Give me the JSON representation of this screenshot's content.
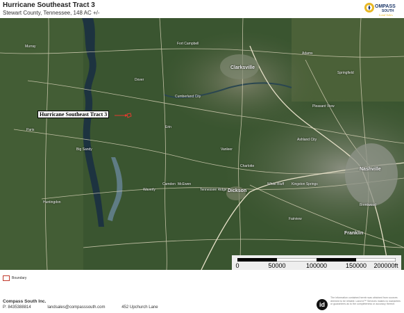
{
  "header": {
    "title": "Hurricane Southeast Tract 3",
    "subtitle": "Stewart County, Tennessee, 148 AC +/-"
  },
  "logo": {
    "text": "OMPASS",
    "sub": "SOUTH",
    "script": "Land Sales",
    "icon": "compass-icon",
    "colors": {
      "gold": "#e8b825",
      "navy": "#1f3a6b"
    }
  },
  "map": {
    "type": "satellite",
    "tract_label": "Hurricane Southeast Tract 3",
    "boundary_color": "#e23b2e",
    "towns": [
      {
        "name": "Murray",
        "big": false
      },
      {
        "name": "Paris",
        "big": false
      },
      {
        "name": "Big Sandy",
        "big": false
      },
      {
        "name": "Dover",
        "big": false
      },
      {
        "name": "Fort Campbell",
        "big": false
      },
      {
        "name": "Clarksville",
        "big": true
      },
      {
        "name": "Springfield",
        "big": false
      },
      {
        "name": "Cumberland City",
        "big": false
      },
      {
        "name": "Erin",
        "big": false
      },
      {
        "name": "Ashland City",
        "big": false
      },
      {
        "name": "Nashville",
        "big": true
      },
      {
        "name": "Dickson",
        "big": true
      },
      {
        "name": "White Bluff",
        "big": false
      },
      {
        "name": "Kingston Springs",
        "big": false
      },
      {
        "name": "Brentwood",
        "big": false
      },
      {
        "name": "Franklin",
        "big": true
      },
      {
        "name": "Waverly",
        "big": false
      },
      {
        "name": "Camden",
        "big": false
      },
      {
        "name": "McEwen",
        "big": false
      },
      {
        "name": "Vanleer",
        "big": false
      },
      {
        "name": "Charlotte",
        "big": false
      },
      {
        "name": "Fairview",
        "big": false
      },
      {
        "name": "Adams",
        "big": false
      },
      {
        "name": "Pleasant View",
        "big": false
      },
      {
        "name": "Huntingdon",
        "big": false
      },
      {
        "name": "Tennessee Ridge",
        "big": false
      }
    ],
    "scale": {
      "labels": [
        "0",
        "50000",
        "100000",
        "150000",
        "200000ft"
      ]
    }
  },
  "legend": {
    "label": "Boundary"
  },
  "footer": {
    "company": "Compass South Inc.",
    "phone": "P: 8435388814",
    "email": "landsales@compasssouth.com",
    "address": "452 Upchurch Lane",
    "id_logo": "id",
    "disclaimer": "The information contained herein was obtained from sources deemed to be reliable. Land id™ Services makes no warranties or guarantees as to the completeness or accuracy thereof."
  }
}
